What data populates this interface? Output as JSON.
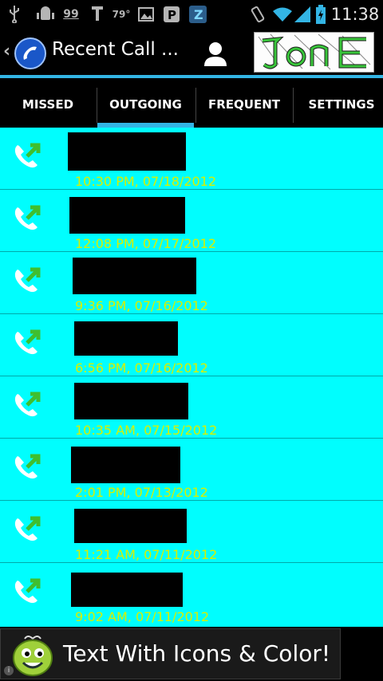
{
  "status_bar": {
    "badge_count": "99",
    "temperature": "79°",
    "time": "11:38",
    "icons": [
      "usb-icon",
      "android-icon",
      "badge-99-icon",
      "tmobile-icon",
      "temperature-icon",
      "image-icon",
      "p-app-icon",
      "z-app-icon",
      "vibrate-icon",
      "wifi-icon",
      "signal-icon",
      "battery-icon"
    ]
  },
  "action_bar": {
    "title": "Recent Call ...",
    "logo_text": "JonE"
  },
  "tabs": [
    {
      "label": "MISSED"
    },
    {
      "label": "OUTGOING"
    },
    {
      "label": "FREQUENT"
    },
    {
      "label": "SETTINGS"
    }
  ],
  "calls": [
    {
      "time": "10:30 PM, 07/18/2012"
    },
    {
      "time": "12:08 PM, 07/17/2012"
    },
    {
      "time": "9:36 PM, 07/16/2012"
    },
    {
      "time": "6:56 PM, 07/16/2012"
    },
    {
      "time": "10:35 AM, 07/15/2012"
    },
    {
      "time": "2:01 PM, 07/13/2012"
    },
    {
      "time": "11:21 AM, 07/11/2012"
    },
    {
      "time": "9:02 AM, 07/11/2012"
    }
  ],
  "ad": {
    "text": "Text With Icons & Color!"
  },
  "colors": {
    "list_bg": "#00fefe",
    "time_text": "#d8f000",
    "accent": "#33b5e5"
  }
}
